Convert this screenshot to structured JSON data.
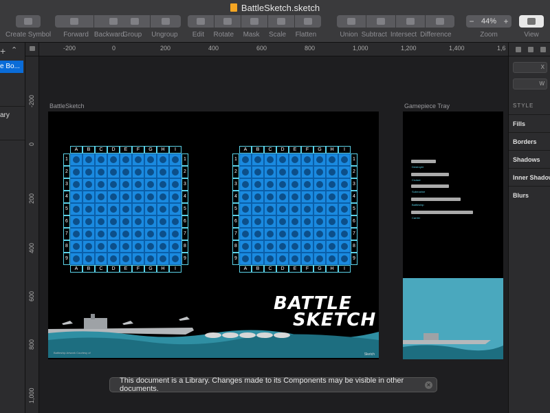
{
  "window": {
    "title": "BattleSketch.sketch"
  },
  "toolbar": {
    "create_symbol": "Create Symbol",
    "forward": "Forward",
    "backward": "Backward",
    "group": "Group",
    "ungroup": "Ungroup",
    "edit": "Edit",
    "rotate": "Rotate",
    "mask": "Mask",
    "scale": "Scale",
    "flatten": "Flatten",
    "union": "Union",
    "subtract": "Subtract",
    "intersect": "Intersect",
    "difference": "Difference",
    "zoom_label": "Zoom",
    "zoom_value": "44%",
    "view_label": "View"
  },
  "left_panel": {
    "selected_item": "e Bo...",
    "library_item": "ary"
  },
  "ruler": {
    "h_ticks": [
      "-200",
      "0",
      "200",
      "400",
      "600",
      "800",
      "1,000",
      "1,200",
      "1,400",
      "1,6"
    ],
    "v_ticks": [
      "-200",
      "0",
      "200",
      "400",
      "600",
      "800",
      "1,000"
    ]
  },
  "artboards": {
    "main": "BattleSketch",
    "tray": "Gamepiece Tray"
  },
  "board": {
    "columns": [
      "A",
      "B",
      "C",
      "D",
      "E",
      "F",
      "G",
      "H",
      "I"
    ],
    "rows": [
      "1",
      "2",
      "3",
      "4",
      "5",
      "6",
      "7",
      "8",
      "9"
    ]
  },
  "logo": {
    "line1": "BATTLE",
    "line2": "SKETCH"
  },
  "credit": "Battleship Artwork Courtesy of",
  "sketch_mark": "Sketch",
  "tray": {
    "ships": [
      "Destroyer",
      "Cruiser",
      "Submarine",
      "Battleship",
      "Carrier"
    ]
  },
  "toast": {
    "message": "This document is a Library. Changes made to its Components may be visible in other documents."
  },
  "inspector": {
    "x_label": "X",
    "w_label": "W",
    "style_heading": "STYLE",
    "sections": [
      "Fills",
      "Borders",
      "Shadows",
      "Inner Shadows",
      "Blurs"
    ]
  }
}
